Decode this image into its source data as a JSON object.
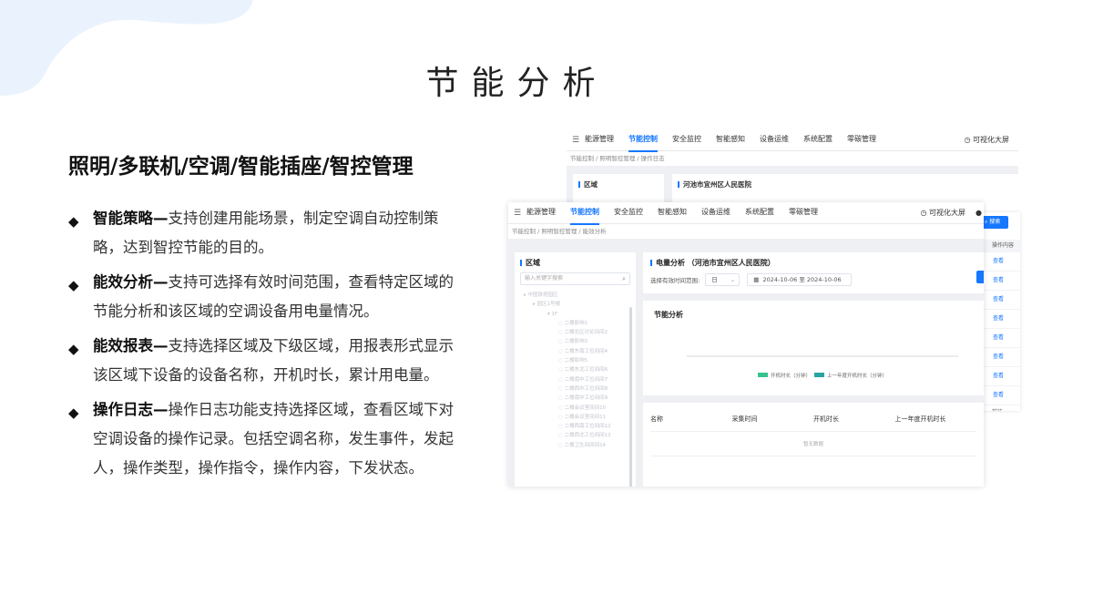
{
  "slide": {
    "title": "节能分析",
    "subtitle": "照明/多联机/空调/智能插座/智控管理"
  },
  "bullets": [
    {
      "head": "智能策略—",
      "text": "支持创建用能场景，制定空调自动控制策略，达到智控节能的目的。"
    },
    {
      "head": "能效分析—",
      "text": "支持可选择有效时间范围，查看特定区域的节能分析和该区域的空调设备用电量情况。"
    },
    {
      "head": "能效报表—",
      "text": "支持选择区域及下级区域，用报表形式显示该区域下设备的设备名称，开机时长，累计用电量。"
    },
    {
      "head": "操作日志—",
      "text": "操作日志功能支持选择区域，查看区域下对空调设备的操作记录。包括空调名称，发生事件，发起人，操作类型，操作指令，操作内容，下发状态。"
    }
  ],
  "app": {
    "nav": [
      "能源管理",
      "节能控制",
      "安全监控",
      "智能感知",
      "设备运维",
      "系统配置",
      "零碳管理"
    ],
    "active_nav": "节能控制",
    "bigscreen": "可视化大屏",
    "back": {
      "breadcrumb": "节能控制 / 照明智控管理 / 操作日志",
      "area_title": "区域",
      "region_title": "河池市宜州区人民医院"
    },
    "front": {
      "breadcrumb": "节能控制 / 照明智控管理 / 能效分析",
      "area_title": "区域",
      "search_placeholder": "输入关键字搜索",
      "tree": [
        {
          "level": 1,
          "label": "中国铁塔园区"
        },
        {
          "level": 2,
          "label": "园区1号楼"
        },
        {
          "level": 3,
          "label": "1F"
        },
        {
          "level": 4,
          "label": "二楼影响1"
        },
        {
          "level": 4,
          "label": "二楼北区讨论间间2"
        },
        {
          "level": 4,
          "label": "二楼影响3"
        },
        {
          "level": 4,
          "label": "二楼东南工位间间4"
        },
        {
          "level": 4,
          "label": "二楼影响5"
        },
        {
          "level": 4,
          "label": "二楼东北工位间间6"
        },
        {
          "level": 4,
          "label": "二楼南中工位间间7"
        },
        {
          "level": 4,
          "label": "二楼西中工位间间8"
        },
        {
          "level": 4,
          "label": "二楼南中工位间间9"
        },
        {
          "level": 4,
          "label": "二楼会议室间间10"
        },
        {
          "level": 4,
          "label": "二楼会议室间间11"
        },
        {
          "level": 4,
          "label": "二楼西南工位间间12"
        },
        {
          "level": 4,
          "label": "二楼西北工位间间13"
        },
        {
          "level": 4,
          "label": "二楼卫生间间间14"
        }
      ],
      "analysis_title": "电量分析",
      "region_name": "（河池市宜州区人民医院）",
      "time_label": "选择有效时间范围:",
      "period_value": "日",
      "date_range": "2024-10-06 至 2024-10-06",
      "chart_title": "节能分析",
      "table_headers": [
        "名称",
        "采集时间",
        "开机时长",
        "上一年度开机时长"
      ],
      "table_empty": "暂无数据"
    },
    "right": {
      "search_button": "搜索",
      "column_header": "操作内容",
      "view_links": [
        "查看",
        "查看",
        "查看",
        "查看",
        "查看",
        "查看",
        "查看",
        "查看"
      ],
      "prev_label": "前往"
    }
  },
  "chart_data": {
    "type": "bar",
    "title": "节能分析",
    "categories": [],
    "series": [
      {
        "name": "开机时长（分钟）",
        "values": [],
        "color": "#34c38f"
      },
      {
        "name": "上一年度开机时长（分钟）",
        "values": [],
        "color": "#2aa3a3"
      }
    ],
    "legend": "bottom"
  },
  "colors": {
    "accent": "#1677ff",
    "deco": "#eaf3fd"
  }
}
